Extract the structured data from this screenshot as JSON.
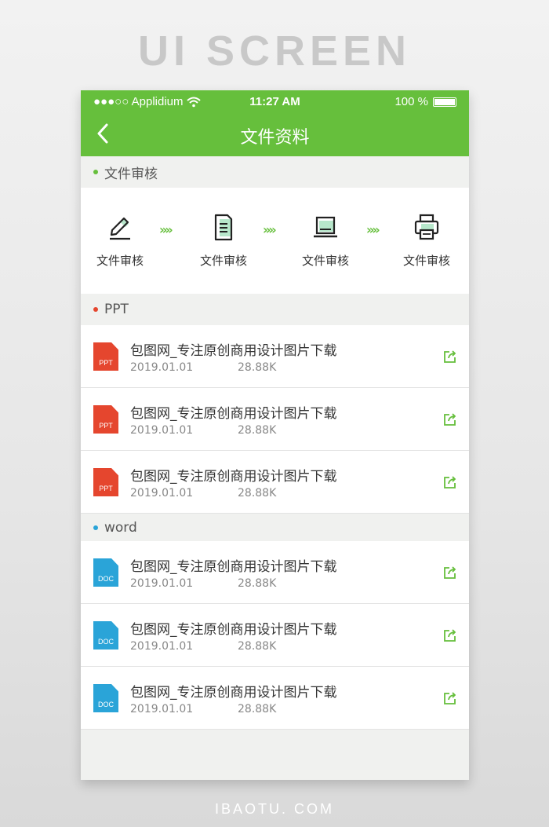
{
  "headline": "UI SCREEN",
  "footer": "IBAOTU. COM",
  "status": {
    "carrier": "●●●○○ Applidium",
    "time": "11:27 AM",
    "battery": "100 %"
  },
  "nav": {
    "title": "文件资料"
  },
  "review": {
    "header": "文件审核",
    "steps": [
      {
        "label": "文件审核",
        "icon": "pen-icon"
      },
      {
        "label": "文件审核",
        "icon": "document-icon"
      },
      {
        "label": "文件审核",
        "icon": "laptop-icon"
      },
      {
        "label": "文件审核",
        "icon": "printer-icon"
      }
    ],
    "chevron": "»»"
  },
  "ppt": {
    "header": "PPT",
    "tag": "PPT",
    "color": "#e5462e",
    "files": [
      {
        "title": "包图网_专注原创商用设计图片下载",
        "date": "2019.01.01",
        "size": "28.88K"
      },
      {
        "title": "包图网_专注原创商用设计图片下载",
        "date": "2019.01.01",
        "size": "28.88K"
      },
      {
        "title": "包图网_专注原创商用设计图片下载",
        "date": "2019.01.01",
        "size": "28.88K"
      }
    ]
  },
  "word": {
    "header": "word",
    "tag": "DOC",
    "color": "#2aa4d8",
    "files": [
      {
        "title": "包图网_专注原创商用设计图片下载",
        "date": "2019.01.01",
        "size": "28.88K"
      },
      {
        "title": "包图网_专注原创商用设计图片下载",
        "date": "2019.01.01",
        "size": "28.88K"
      },
      {
        "title": "包图网_专注原创商用设计图片下载",
        "date": "2019.01.01",
        "size": "28.88K"
      }
    ]
  },
  "colors": {
    "accent": "#66bf3c"
  }
}
